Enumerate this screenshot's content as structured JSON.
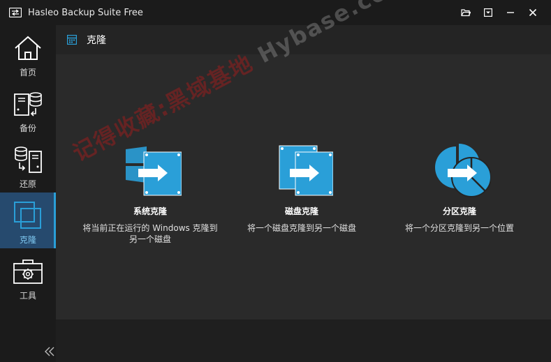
{
  "window": {
    "title": "Hasleo Backup Suite Free"
  },
  "sidebar": {
    "items": [
      {
        "label": "首页",
        "icon": "home-icon"
      },
      {
        "label": "备份",
        "icon": "backup-icon"
      },
      {
        "label": "还原",
        "icon": "restore-icon"
      },
      {
        "label": "克隆",
        "icon": "clone-icon"
      },
      {
        "label": "工具",
        "icon": "toolbox-icon"
      }
    ],
    "active_index": 3
  },
  "section": {
    "title": "克隆"
  },
  "options": [
    {
      "title": "系统克隆",
      "desc": "将当前正在运行的 Windows 克隆到另一个磁盘",
      "icon": "system-clone-icon"
    },
    {
      "title": "磁盘克隆",
      "desc": "将一个磁盘克隆到另一个磁盘",
      "icon": "disk-clone-icon"
    },
    {
      "title": "分区克隆",
      "desc": "将一个分区克隆到另一个位置",
      "icon": "partition-clone-icon"
    }
  ],
  "watermark": {
    "cn": "记得收藏:黑域基地",
    "en": "Hybase.com"
  },
  "colors": {
    "accent": "#2a9fd8",
    "active_bg": "#264a6e",
    "sidebar_bg": "#1b1b1b",
    "panel_bg": "#2a2a2a"
  }
}
